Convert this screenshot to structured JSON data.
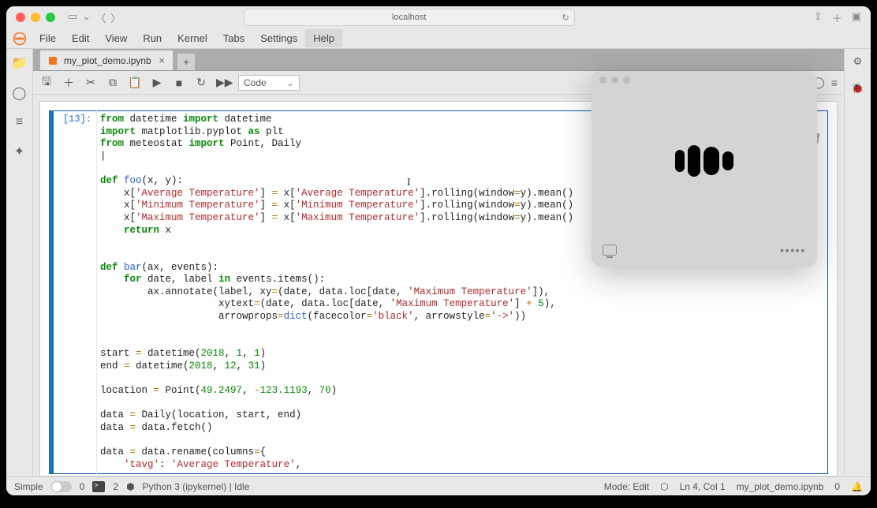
{
  "chrome": {
    "url": "localhost"
  },
  "menus": [
    "File",
    "Edit",
    "View",
    "Run",
    "Kernel",
    "Tabs",
    "Settings",
    "Help"
  ],
  "tab": {
    "title": "my_plot_demo.ipynb"
  },
  "toolbar": {
    "celltype": "Code"
  },
  "cell": {
    "prompt": "[13]:",
    "lines": [
      {
        "h": "<span class='kw'>from</span> datetime <span class='kw'>import</span> datetime"
      },
      {
        "h": "<span class='kw'>import</span> matplotlib.pyplot <span class='kw'>as</span> plt"
      },
      {
        "h": "<span class='kw'>from</span> meteostat <span class='kw'>import</span> Point, Daily"
      },
      {
        "h": "|"
      },
      {
        "h": ""
      },
      {
        "h": "<span class='kw'>def</span> <span class='fn'>foo</span>(x, y):"
      },
      {
        "h": "    x[<span class='str'>'Average Temperature'</span>] <span class='op'>=</span> x[<span class='str'>'Average Temperature'</span>].rolling(window<span class='op'>=</span>y).mean()"
      },
      {
        "h": "    x[<span class='str'>'Minimum Temperature'</span>] <span class='op'>=</span> x[<span class='str'>'Minimum Temperature'</span>].rolling(window<span class='op'>=</span>y).mean()"
      },
      {
        "h": "    x[<span class='str'>'Maximum Temperature'</span>] <span class='op'>=</span> x[<span class='str'>'Maximum Temperature'</span>].rolling(window<span class='op'>=</span>y).mean()"
      },
      {
        "h": "    <span class='kw'>return</span> x"
      },
      {
        "h": ""
      },
      {
        "h": ""
      },
      {
        "h": "<span class='kw'>def</span> <span class='fn'>bar</span>(ax, events):"
      },
      {
        "h": "    <span class='kw'>for</span> date, label <span class='kw'>in</span> events.items():"
      },
      {
        "h": "        ax.annotate(label, xy<span class='op'>=</span>(date, data.loc[date, <span class='str'>'Maximum Temperature'</span>]),"
      },
      {
        "h": "                    xytext<span class='op'>=</span>(date, data.loc[date, <span class='str'>'Maximum Temperature'</span>] <span class='op'>+</span> <span class='num'>5</span>),"
      },
      {
        "h": "                    arrowprops<span class='op'>=</span><span class='fn'>dict</span>(facecolor<span class='op'>=</span><span class='str'>'black'</span>, arrowstyle<span class='op'>=</span><span class='str'>'-&gt;'</span>))"
      },
      {
        "h": ""
      },
      {
        "h": ""
      },
      {
        "h": "start <span class='op'>=</span> datetime(<span class='num'>2018</span>, <span class='num'>1</span>, <span class='num'>1</span>)"
      },
      {
        "h": "end <span class='op'>=</span> datetime(<span class='num'>2018</span>, <span class='num'>12</span>, <span class='num'>31</span>)"
      },
      {
        "h": ""
      },
      {
        "h": "location <span class='op'>=</span> Point(<span class='num'>49.2497</span>, <span class='op'>-</span><span class='num'>123.1193</span>, <span class='num'>70</span>)"
      },
      {
        "h": ""
      },
      {
        "h": "data <span class='op'>=</span> Daily(location, start, end)"
      },
      {
        "h": "data <span class='op'>=</span> data.fetch()"
      },
      {
        "h": ""
      },
      {
        "h": "data <span class='op'>=</span> data.rename(columns<span class='op'>=</span>{"
      },
      {
        "h": "    <span class='str'>'tavg'</span>: <span class='str'>'Average Temperature'</span>,"
      }
    ]
  },
  "status": {
    "left1": "Simple",
    "left2": "0",
    "left3": "2",
    "kernel": "Python 3 (ipykernel) | Idle",
    "mode": "Mode: Edit",
    "pos": "Ln 4, Col 1",
    "file": "my_plot_demo.ipynb",
    "right_count": "0"
  },
  "overlay": {
    "dots": "•••••"
  }
}
